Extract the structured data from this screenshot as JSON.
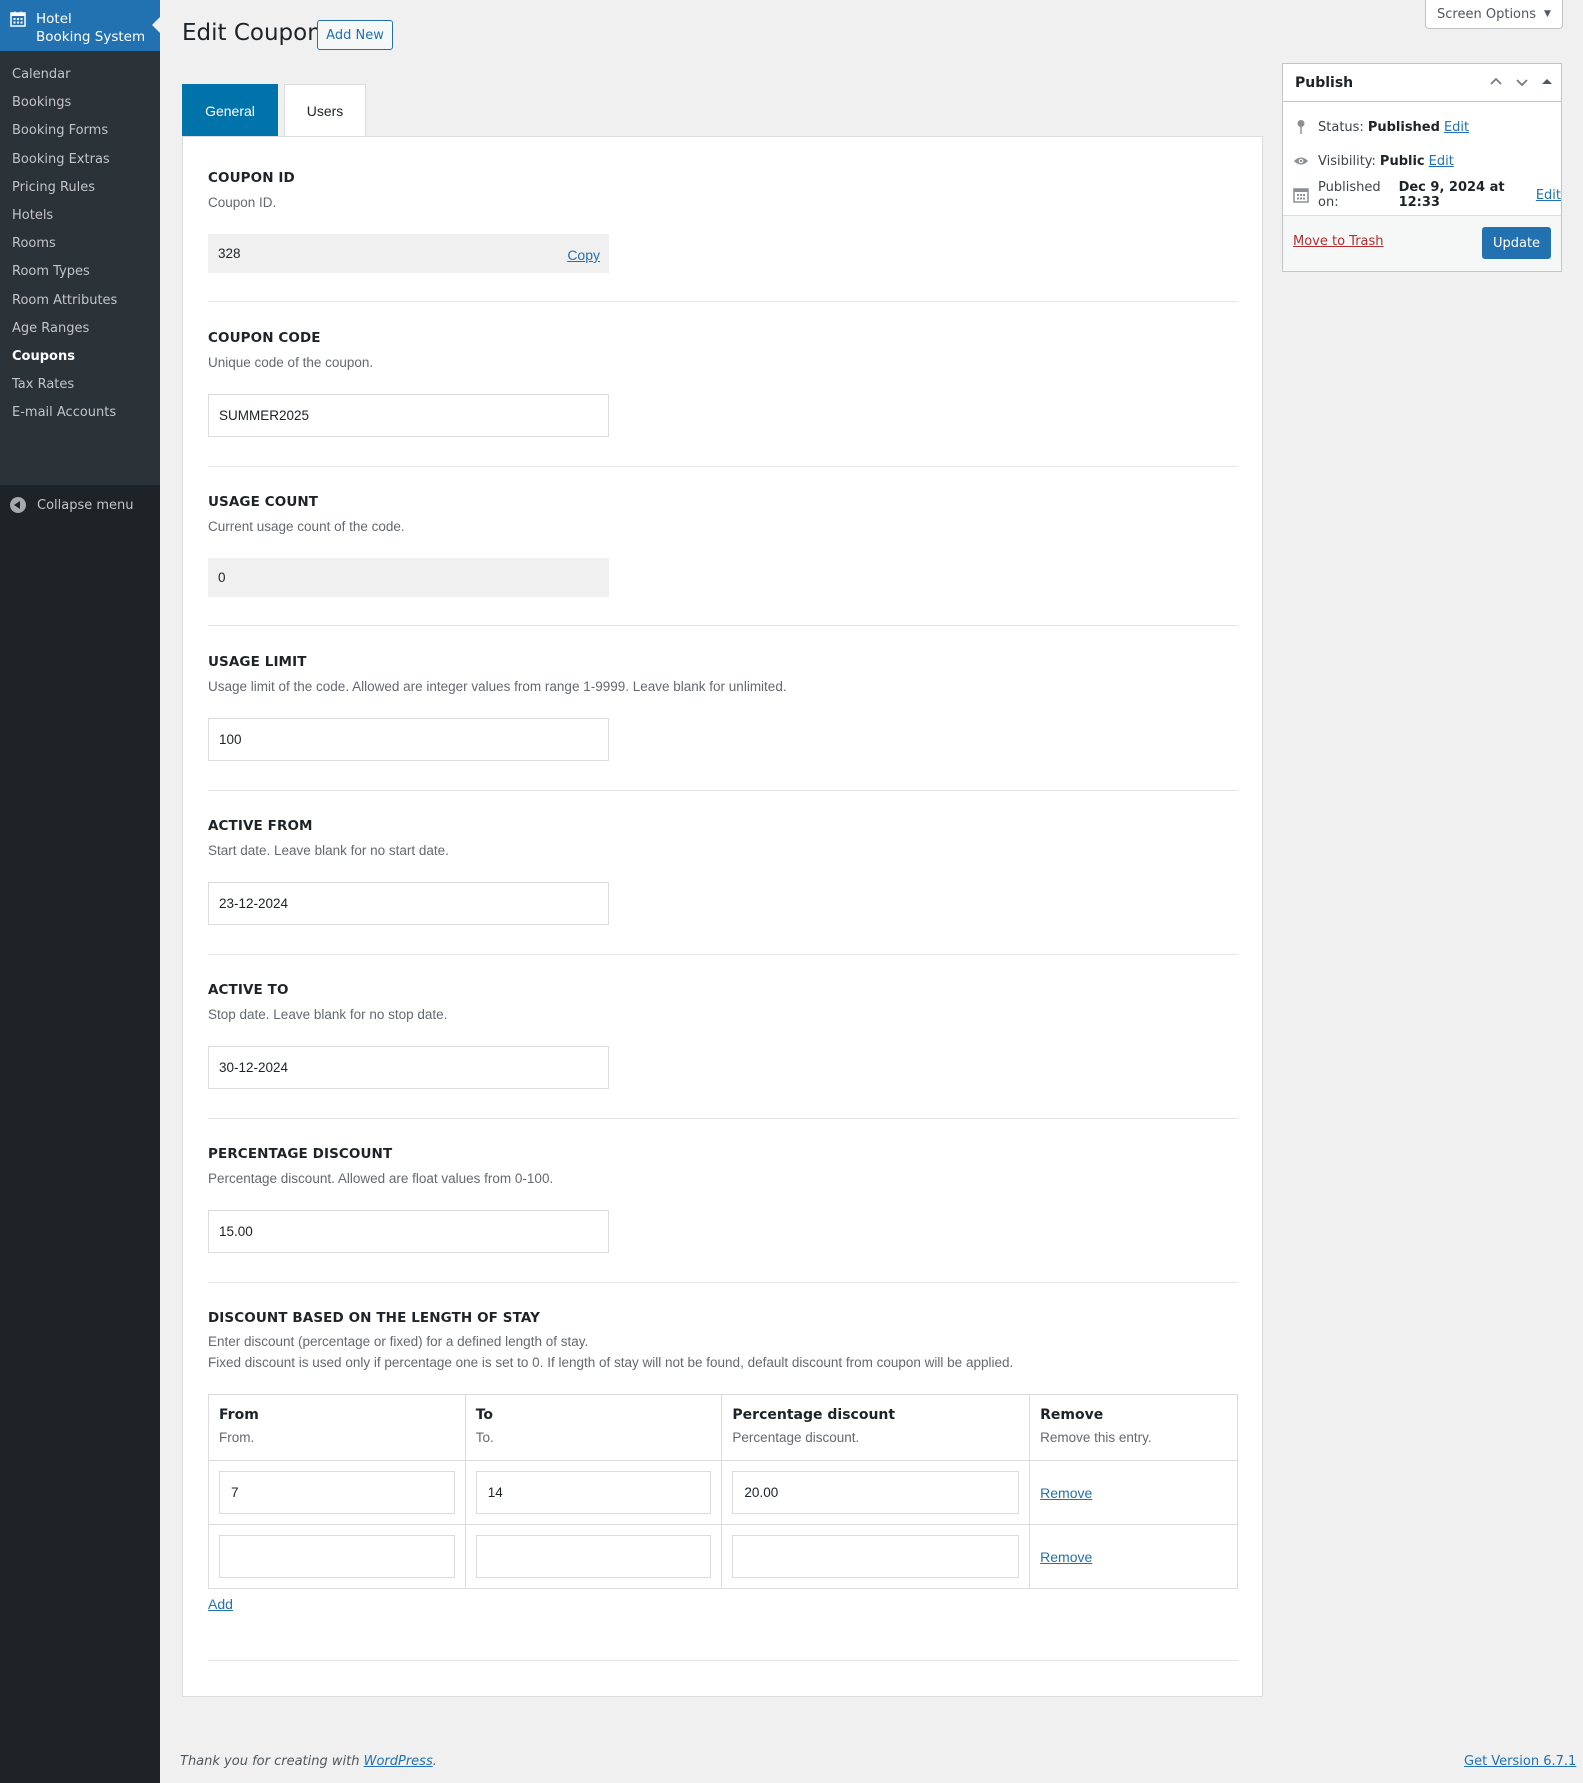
{
  "sidebar": {
    "brand_line1": "Hotel",
    "brand_line2": "Booking System",
    "items": [
      "Calendar",
      "Bookings",
      "Booking Forms",
      "Booking Extras",
      "Pricing Rules",
      "Hotels",
      "Rooms",
      "Room Types",
      "Room Attributes",
      "Age Ranges",
      "Coupons",
      "Tax Rates",
      "E-mail Accounts"
    ],
    "active": "Coupons",
    "collapse_label": "Collapse menu"
  },
  "header": {
    "title": "Edit Coupon",
    "add_new": "Add New",
    "screen_options": "Screen Options"
  },
  "tabs": {
    "general": "General",
    "users": "Users"
  },
  "fields": {
    "coupon_id": {
      "label": "COUPON ID",
      "desc": "Coupon ID.",
      "value": "328",
      "copy": "Copy"
    },
    "coupon_code": {
      "label": "COUPON CODE",
      "desc": "Unique code of the coupon.",
      "value": "SUMMER2025"
    },
    "usage_count": {
      "label": "USAGE COUNT",
      "desc": "Current usage count of the code.",
      "value": "0"
    },
    "usage_limit": {
      "label": "USAGE LIMIT",
      "desc": "Usage limit of the code. Allowed are integer values from range 1-9999. Leave blank for unlimited.",
      "value": "100"
    },
    "active_from": {
      "label": "ACTIVE FROM",
      "desc": "Start date. Leave blank for no start date.",
      "value": "23-12-2024"
    },
    "active_to": {
      "label": "ACTIVE TO",
      "desc": "Stop date. Leave blank for no stop date.",
      "value": "30-12-2024"
    },
    "percentage_discount": {
      "label": "PERCENTAGE DISCOUNT",
      "desc": "Percentage discount. Allowed are float values from 0-100.",
      "value": "15.00"
    },
    "length_of_stay": {
      "label": "DISCOUNT BASED ON THE LENGTH OF STAY",
      "desc1": "Enter discount (percentage or fixed) for a defined length of stay.",
      "desc2": "Fixed discount is used only if percentage one is set to 0. If length of stay will not be found, default discount from coupon will be applied.",
      "columns": [
        {
          "title": "From",
          "sub": "From."
        },
        {
          "title": "To",
          "sub": "To."
        },
        {
          "title": "Percentage discount",
          "sub": "Percentage discount."
        },
        {
          "title": "Remove",
          "sub": "Remove this entry."
        }
      ],
      "rows": [
        {
          "from": "7",
          "to": "14",
          "percentage": "20.00",
          "remove": "Remove"
        },
        {
          "from": "",
          "to": "",
          "percentage": "",
          "remove": "Remove"
        }
      ],
      "add": "Add"
    }
  },
  "publish": {
    "title": "Publish",
    "status_label": "Status:",
    "status_value": "Published",
    "visibility_label": "Visibility:",
    "visibility_value": "Public",
    "published_label": "Published on:",
    "published_value": "Dec 9, 2024 at 12:33",
    "edit": "Edit",
    "trash": "Move to Trash",
    "update": "Update"
  },
  "footer": {
    "thanks_prefix": "Thank you for creating with",
    "wordpress": "WordPress",
    "thanks_suffix": ".",
    "version": "Get Version 6.7.1"
  }
}
